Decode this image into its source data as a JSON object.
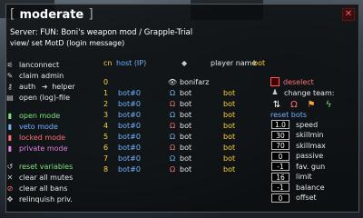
{
  "window": {
    "title": "moderate",
    "bracket_left": "[",
    "bracket_right": "]",
    "close_glyph": "✕"
  },
  "server_line": "Server: FUN: Boni's weapon mod / Grapple-Trial",
  "motd_line": "view/ set MotD (login message)",
  "menu": {
    "lanconnect": "lanconnect",
    "claim_admin": "claim admin",
    "auth": "auth",
    "helper": "helper",
    "open_log": "open (log)-file",
    "open_mode": "open mode",
    "veto_mode": "veto mode",
    "locked_mode": "locked mode",
    "private_mode": "private mode",
    "reset_variables": "reset variables",
    "clear_mutes": "clear all mutes",
    "clear_bans": "clear all bans",
    "relinquish": "relinquish priv."
  },
  "table": {
    "col_cn": "cn",
    "col_host": "host (IP)",
    "col_name": "player name",
    "col_type": "bot",
    "rows": [
      {
        "cn": "0",
        "host": "",
        "name": "bonifarz",
        "type": "",
        "team": "red"
      },
      {
        "cn": "1",
        "host": "bot#0",
        "name": "bot",
        "type": "bot",
        "team": "blue"
      },
      {
        "cn": "2",
        "host": "bot#0",
        "name": "bot",
        "type": "bot",
        "team": "red"
      },
      {
        "cn": "3",
        "host": "bot#0",
        "name": "bot",
        "type": "bot",
        "team": "blue"
      },
      {
        "cn": "4",
        "host": "bot#0",
        "name": "bot",
        "type": "bot",
        "team": "red"
      },
      {
        "cn": "5",
        "host": "bot#0",
        "name": "bot",
        "type": "bot",
        "team": "blue"
      },
      {
        "cn": "6",
        "host": "bot#0",
        "name": "bot",
        "type": "bot",
        "team": "red"
      },
      {
        "cn": "7",
        "host": "bot#0",
        "name": "bot",
        "type": "bot",
        "team": "blue"
      },
      {
        "cn": "8",
        "host": "bot#0",
        "name": "bot",
        "type": "bot",
        "team": "red"
      }
    ]
  },
  "panel": {
    "deselect": "deselect",
    "change_team": "change team:",
    "reset_bots": "reset bots",
    "settings": [
      {
        "value": "1.0",
        "label": "speed"
      },
      {
        "value": "30",
        "label": "skillmin"
      },
      {
        "value": "70",
        "label": "skillmax"
      },
      {
        "value": "0",
        "label": "passive"
      },
      {
        "value": "-1",
        "label": "fav. gun"
      },
      {
        "value": "16",
        "label": "limit"
      },
      {
        "value": "-1",
        "label": "balance"
      },
      {
        "value": "0",
        "label": "offset"
      }
    ]
  },
  "colors": {
    "green": "#7fe27f",
    "blue": "#6fb2ff",
    "red": "#ff7070",
    "magenta": "#e07fe0",
    "yellow": "#ffd23a"
  }
}
